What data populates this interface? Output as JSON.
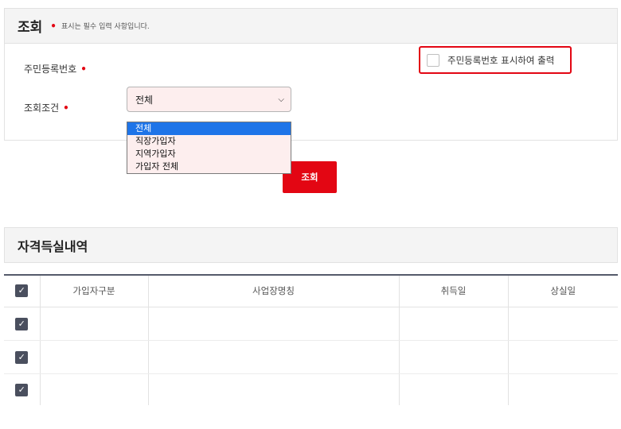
{
  "search": {
    "title": "조회",
    "required_mark": "•",
    "required_note": "표시는 필수 입력 사항입니다.",
    "rrn_label": "주민등록번호",
    "show_rrn_label": "주민등록번호 표시하여 출력",
    "condition_label": "조회조건",
    "condition_selected": "전체",
    "condition_options": [
      "전체",
      "직장가입자",
      "지역가입자",
      "가입자 전체"
    ],
    "search_button": "조회"
  },
  "history": {
    "title": "자격득실내역",
    "columns": [
      "가입자구분",
      "사업장명칭",
      "취득일",
      "상실일"
    ]
  },
  "icons": {
    "chevron": "chevron-down-icon",
    "check": "check-icon"
  },
  "colors": {
    "accent_red": "#e30613",
    "select_highlight": "#1e74e8",
    "checkbox_dark": "#4a4f5e"
  }
}
